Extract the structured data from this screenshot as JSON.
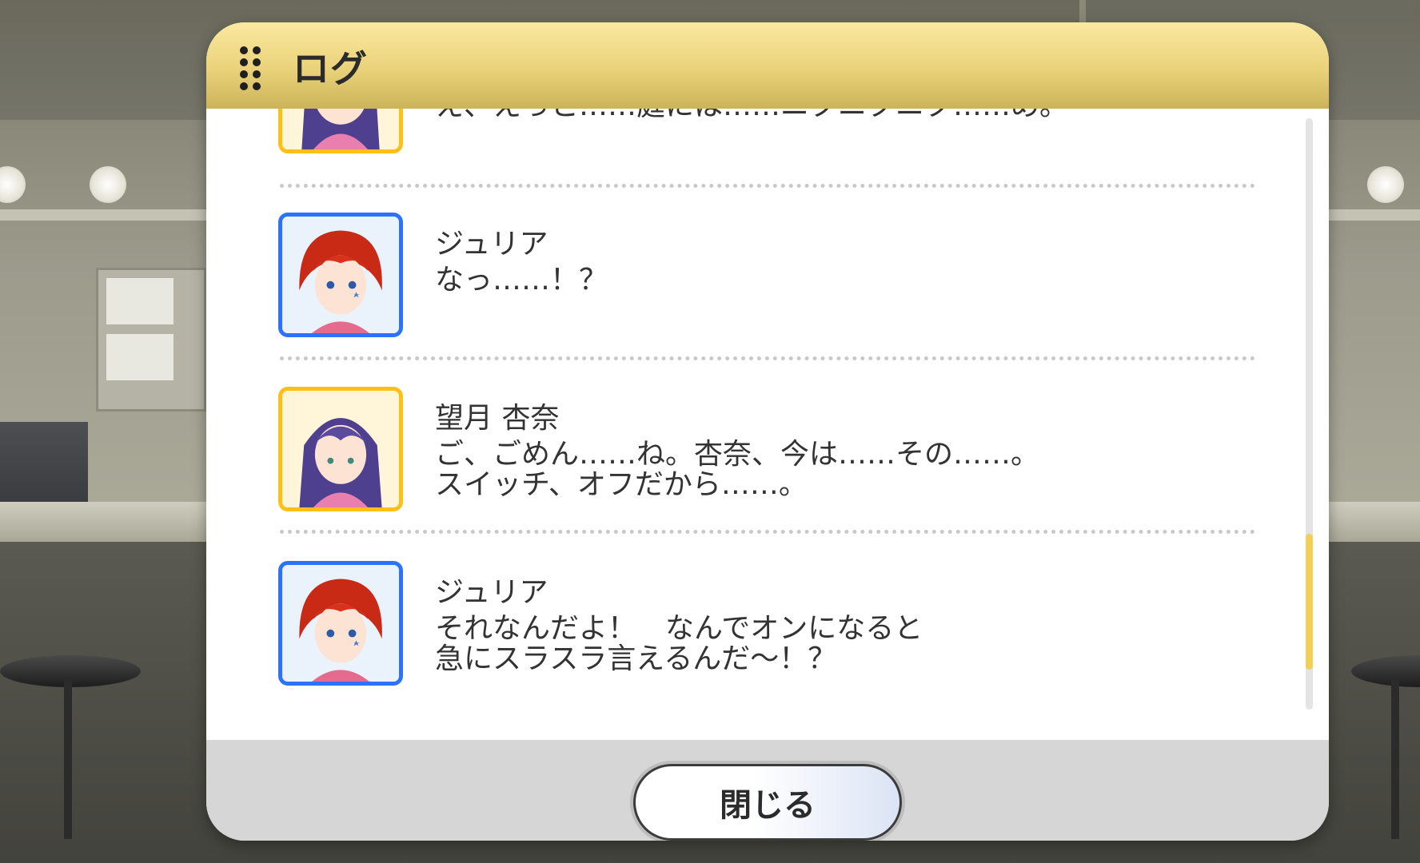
{
  "dialog": {
    "title": "ログ",
    "close_label": "閉じる"
  },
  "log": {
    "entries": [
      {
        "speaker": "",
        "text": "え、えっと……庭には……ニクニクニク……め。",
        "character": "anna",
        "frame_color": "#ffbf17"
      },
      {
        "speaker": "ジュリア",
        "text": "なっ……！？",
        "character": "julia",
        "frame_color": "#2b73ff"
      },
      {
        "speaker": "望月 杏奈",
        "text": "ご、ごめん……ね。杏奈、今は……その……。\nスイッチ、オフだから……。",
        "character": "anna",
        "frame_color": "#ffbf17"
      },
      {
        "speaker": "ジュリア",
        "text": "それなんだよ！　なんでオンになると\n急にスラスラ言えるんだ～！？",
        "character": "julia",
        "frame_color": "#2b73ff"
      }
    ]
  },
  "icons": {
    "grip": "drag-handle-icon",
    "avatar_julia": "red-hair-girl-portrait",
    "avatar_anna": "purple-hair-girl-portrait"
  },
  "colors": {
    "header": "#ead27a",
    "accent_scroll": "#f2cf55",
    "julia_frame": "#2b73ff",
    "anna_frame": "#ffbf17"
  }
}
